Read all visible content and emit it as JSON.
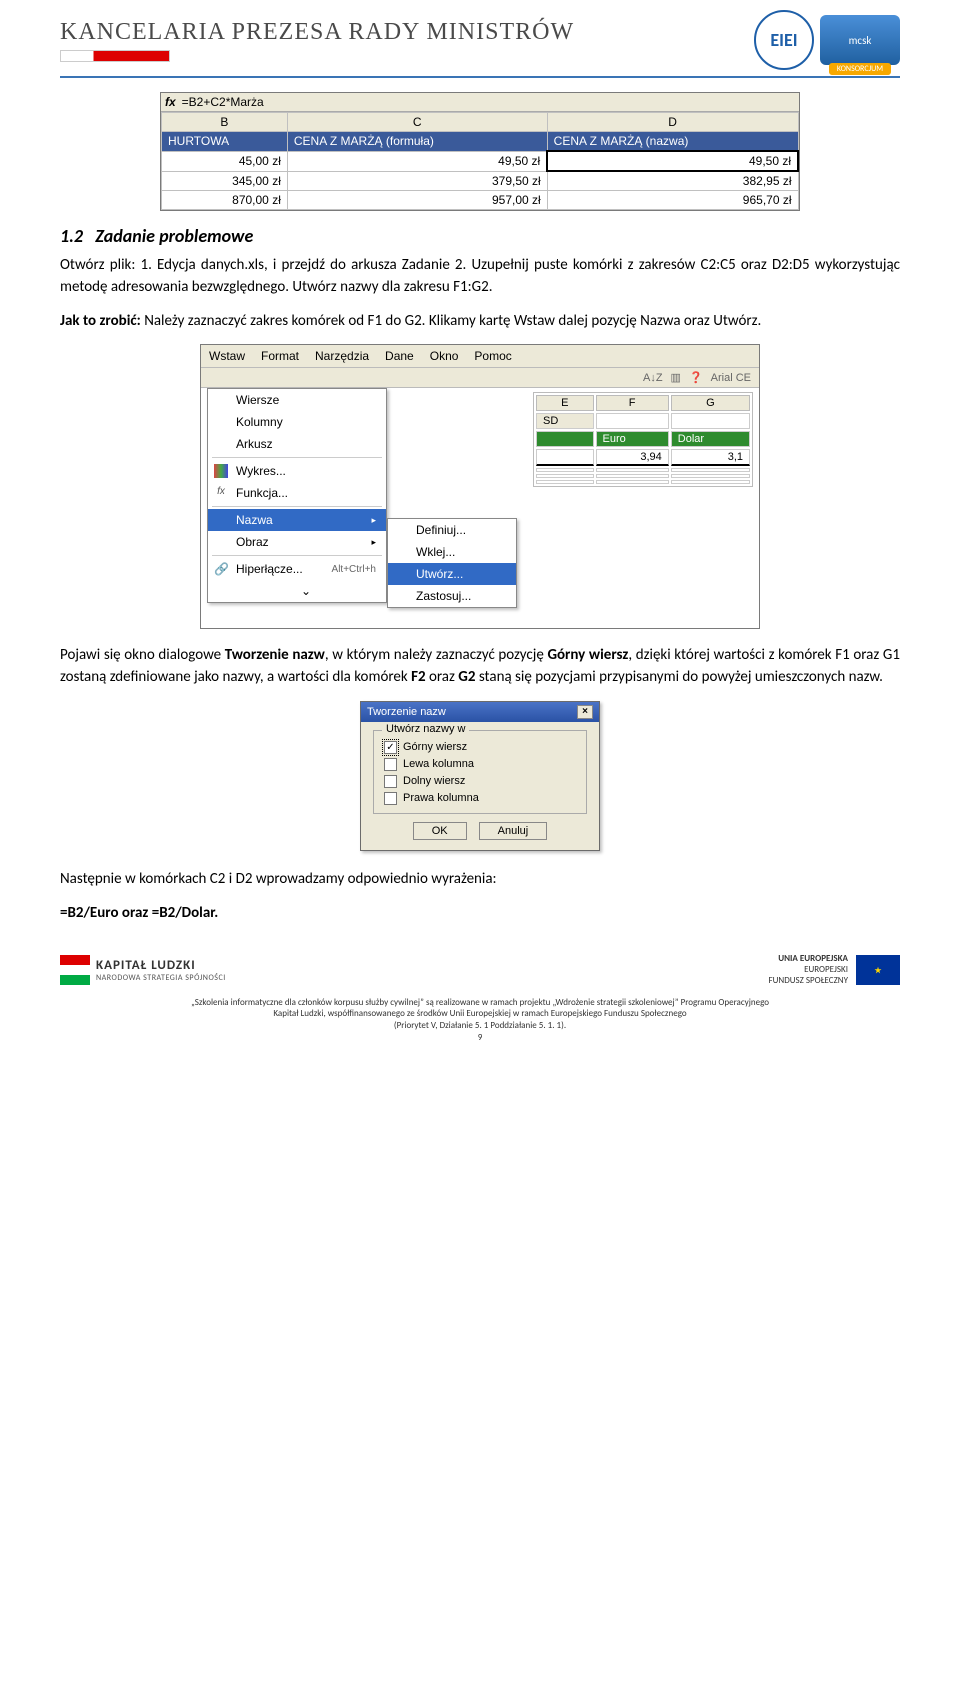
{
  "header": {
    "kprm_title": "KANCELARIA PREZESA RADY MINISTRÓW",
    "ei_label": "EIEI",
    "mcsk_label": "mcsk",
    "konsorcjum": "KONSORCJUM"
  },
  "excel1": {
    "fx_label": "fx",
    "formula": "=B2+C2*Marża",
    "cols": [
      "B",
      "C",
      "D"
    ],
    "hdr": [
      "HURTOWA",
      "CENA Z MARŻĄ (formuła)",
      "CENA Z MARŻĄ (nazwa)"
    ],
    "rows": [
      [
        "45,00 zł",
        "49,50 zł",
        "49,50 zł"
      ],
      [
        "345,00 zł",
        "379,50 zł",
        "382,95 zł"
      ],
      [
        "870,00 zł",
        "957,00 zł",
        "965,70 zł"
      ]
    ]
  },
  "text": {
    "section_num": "1.2",
    "section_title": "Zadanie problemowe",
    "p1": "Otwórz plik: 1. Edycja danych.xls, i przejdź do arkusza Zadanie 2. Uzupełnij puste komórki z zakresów C2:C5 oraz D2:D5 wykorzystując metodę adresowania bezwzględnego. Utwórz nazwy dla zakresu F1:G2.",
    "p2_prefix": "Jak to zrobić:",
    "p2_rest": " Należy zaznaczyć zakres komórek od F1 do G2. Klikamy kartę Wstaw dalej pozycję Nazwa oraz Utwórz.",
    "p3_a": "Pojawi się okno dialogowe ",
    "p3_b": "Tworzenie nazw",
    "p3_c": ", w którym należy zaznaczyć pozycję ",
    "p3_d": "Górny wiersz",
    "p3_e": ", dzięki której wartości z komórek F1 oraz G1 zostaną zdefiniowane jako nazwy, a wartości dla komórek ",
    "p3_f": "F2",
    "p3_g": " oraz ",
    "p3_h": "G2",
    "p3_i": " staną się pozycjami przypisanymi do powyżej umieszczonych nazw.",
    "p4": "Następnie w komórkach C2 i D2 wprowadzamy odpowiednio wyrażenia:",
    "p5": "=B2/Euro oraz =B2/Dolar."
  },
  "menu": {
    "bar": [
      "Wstaw",
      "Format",
      "Narzędzia",
      "Dane",
      "Okno",
      "Pomoc"
    ],
    "toolbar_font": "Arial CE",
    "items": [
      {
        "label": "Wiersze"
      },
      {
        "label": "Kolumny"
      },
      {
        "label": "Arkusz"
      },
      {
        "label": "Wykres...",
        "icon": "chart-icon"
      },
      {
        "label": "Funkcja...",
        "icon": "fx-icon"
      },
      {
        "label": "Nazwa",
        "sub": true,
        "hl": true
      },
      {
        "label": "Obraz",
        "sub": true
      },
      {
        "label": "Hiperłącze...",
        "shortcut": "Alt+Ctrl+h",
        "icon": "link-icon"
      }
    ],
    "subitems": [
      "Definiuj...",
      "Wklej...",
      "Utwórz...",
      "Zastosuj..."
    ],
    "subitem_hl_index": 2,
    "sheet_cols": [
      "E",
      "F",
      "G"
    ],
    "sheet_sd": "SD",
    "sheet_hdr": [
      "",
      "Euro",
      "Dolar"
    ],
    "sheet_vals": [
      "",
      "3,94",
      "3,1"
    ]
  },
  "dialog": {
    "title": "Tworzenie nazw",
    "legend": "Utwórz nazwy w",
    "options": [
      {
        "label": "Górny wiersz",
        "checked": true,
        "focus": true
      },
      {
        "label": "Lewa kolumna",
        "checked": false
      },
      {
        "label": "Dolny wiersz",
        "checked": false
      },
      {
        "label": "Prawa kolumna",
        "checked": false
      }
    ],
    "ok": "OK",
    "cancel": "Anuluj"
  },
  "footer": {
    "kl_title": "KAPITAŁ LUDZKI",
    "kl_sub": "NARODOWA STRATEGIA SPÓJNOŚCI",
    "ue_l1": "UNIA EUROPEJSKA",
    "ue_l2": "EUROPEJSKI",
    "ue_l3": "FUNDUSZ SPOŁECZNY",
    "line1": "„Szkolenia informatyczne dla członków korpusu służby cywilnej” są realizowane w ramach projektu „Wdrożenie strategii szkoleniowej” Programu Operacyjnego",
    "line2": "Kapitał Ludzki, współfinansowanego ze środków Unii Europejskiej w ramach Europejskiego Funduszu Społecznego",
    "line3": "(Priorytet V, Działanie 5. 1 Poddziałanie 5. 1. 1).",
    "page": "9"
  }
}
